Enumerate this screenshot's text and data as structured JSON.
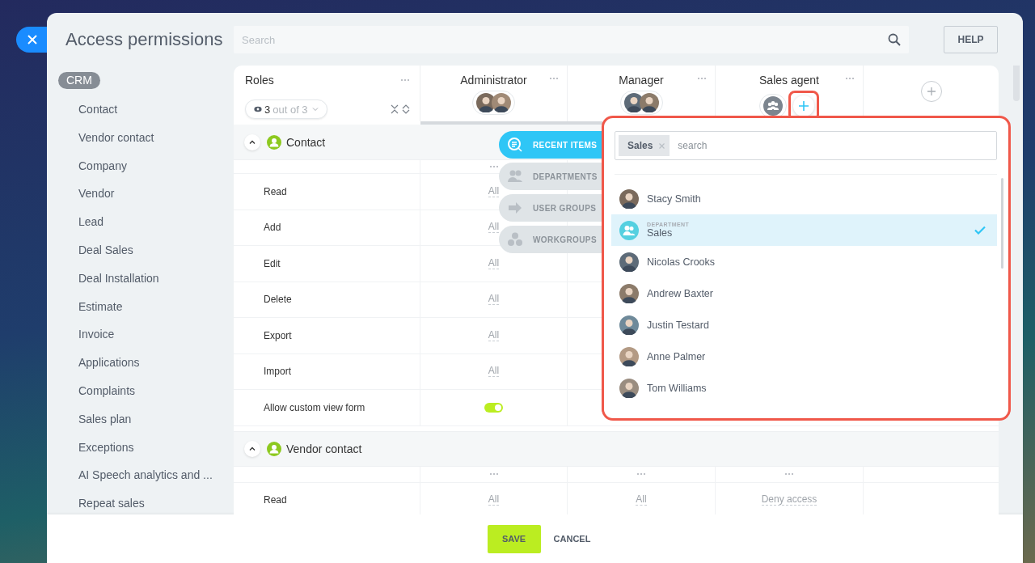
{
  "window": {
    "title": "Access permissions"
  },
  "search": {
    "placeholder": "Search"
  },
  "help_button": "HELP",
  "sidebar": {
    "group": "CRM",
    "items": [
      {
        "label": "Contact"
      },
      {
        "label": "Vendor contact"
      },
      {
        "label": "Company"
      },
      {
        "label": "Vendor"
      },
      {
        "label": "Lead"
      },
      {
        "label": "Deal Sales"
      },
      {
        "label": "Deal Installation"
      },
      {
        "label": "Estimate"
      },
      {
        "label": "Invoice"
      },
      {
        "label": "Applications"
      },
      {
        "label": "Complaints"
      },
      {
        "label": "Sales plan"
      },
      {
        "label": "Exceptions"
      },
      {
        "label": "AI Speech analytics and ..."
      },
      {
        "label": "Repeat sales"
      }
    ]
  },
  "table": {
    "roles_header": {
      "title": "Roles",
      "filter_count": "3",
      "filter_total": "out of 3"
    },
    "roles": [
      {
        "title": "Administrator",
        "members": [
          {
            "kind": "user"
          },
          {
            "kind": "user"
          }
        ],
        "add_button": false
      },
      {
        "title": "Manager",
        "members": [
          {
            "kind": "user"
          },
          {
            "kind": "user"
          }
        ],
        "add_button": false
      },
      {
        "title": "Sales agent",
        "members": [
          {
            "kind": "department"
          }
        ],
        "add_button": true,
        "highlighted": true
      }
    ],
    "sections": [
      {
        "title": "Contact",
        "expanded": true,
        "rows": [
          {
            "label": "Read",
            "cells": [
              {
                "kind": "text",
                "value": "All"
              }
            ]
          },
          {
            "label": "Add",
            "cells": [
              {
                "kind": "text",
                "value": "All"
              }
            ]
          },
          {
            "label": "Edit",
            "cells": [
              {
                "kind": "text",
                "value": "All"
              }
            ]
          },
          {
            "label": "Delete",
            "cells": [
              {
                "kind": "text",
                "value": "All"
              }
            ]
          },
          {
            "label": "Export",
            "cells": [
              {
                "kind": "text",
                "value": "All"
              }
            ]
          },
          {
            "label": "Import",
            "cells": [
              {
                "kind": "text",
                "value": "All"
              }
            ]
          },
          {
            "label": "Allow custom view form",
            "cells": [
              {
                "kind": "toggle",
                "on": true
              }
            ]
          }
        ]
      },
      {
        "title": "Vendor contact",
        "expanded": true,
        "rows": [
          {
            "label": "Read",
            "cells": [
              {
                "kind": "text",
                "value": "All"
              },
              {
                "kind": "text",
                "value": "All"
              },
              {
                "kind": "text",
                "value": "Deny access"
              }
            ]
          }
        ]
      }
    ]
  },
  "selector": {
    "tabs": [
      {
        "label": "RECENT ITEMS",
        "kind": "recent",
        "selected": true
      },
      {
        "label": "DEPARTMENTS",
        "kind": "departments",
        "selected": false
      },
      {
        "label": "USER GROUPS",
        "kind": "groups",
        "selected": false
      },
      {
        "label": "WORKGROUPS",
        "kind": "workgroups",
        "selected": false
      }
    ],
    "tags": [
      {
        "label": "Sales"
      }
    ],
    "placeholder": "search",
    "items": [
      {
        "kind": "user",
        "name": "Stacy Smith",
        "selected": false
      },
      {
        "kind": "department",
        "caption": "DEPARTMENT",
        "name": "Sales",
        "selected": true
      },
      {
        "kind": "user",
        "name": "Nicolas Crooks",
        "selected": false
      },
      {
        "kind": "user",
        "name": "Andrew Baxter",
        "selected": false
      },
      {
        "kind": "user",
        "name": "Justin Testard",
        "selected": false
      },
      {
        "kind": "user",
        "name": "Anne Palmer",
        "selected": false
      },
      {
        "kind": "user",
        "name": "Tom Williams",
        "selected": false
      }
    ]
  },
  "footer": {
    "save": "SAVE",
    "cancel": "CANCEL"
  }
}
